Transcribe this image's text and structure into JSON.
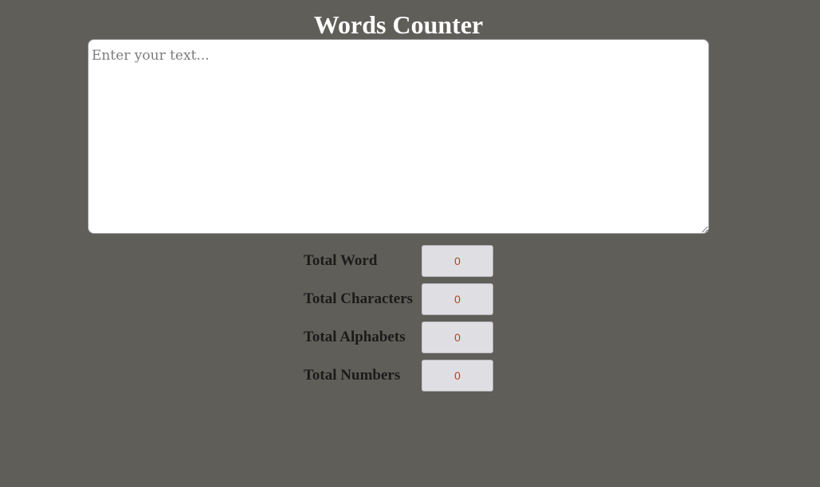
{
  "header": {
    "title": "Words Counter"
  },
  "editor": {
    "placeholder": "Enter your text...",
    "value": ""
  },
  "stats": {
    "items": [
      {
        "label": "Total Word",
        "value": "0"
      },
      {
        "label": "Total Characters",
        "value": "0"
      },
      {
        "label": "Total Alphabets",
        "value": "0"
      },
      {
        "label": "Total Numbers",
        "value": "0"
      }
    ]
  },
  "colors": {
    "background": "#5f5e59",
    "title_text": "#ffffff",
    "label_text": "#1c1b1a",
    "value_text": "#b5412a",
    "value_box": "#dfdfe3"
  }
}
